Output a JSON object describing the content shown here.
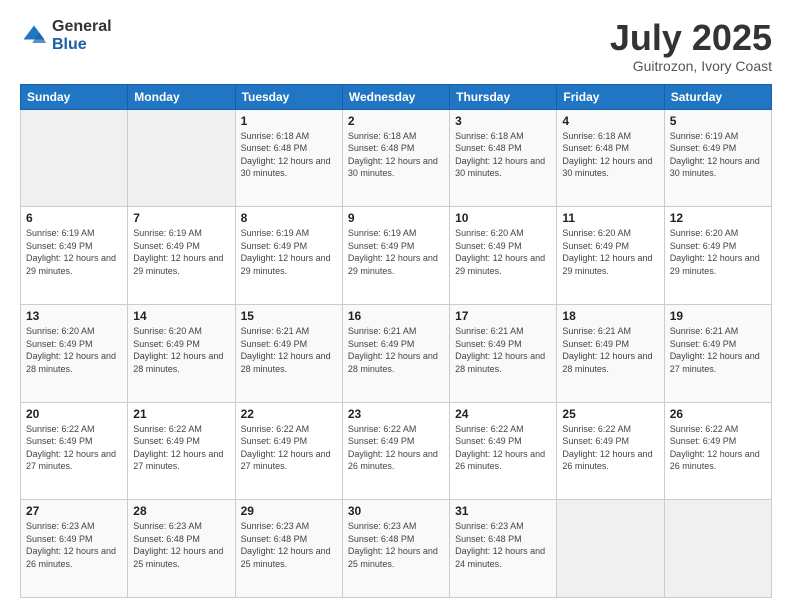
{
  "logo": {
    "general": "General",
    "blue": "Blue"
  },
  "header": {
    "month": "July 2025",
    "location": "Guitrozon, Ivory Coast"
  },
  "weekdays": [
    "Sunday",
    "Monday",
    "Tuesday",
    "Wednesday",
    "Thursday",
    "Friday",
    "Saturday"
  ],
  "weeks": [
    [
      {
        "day": "",
        "sunrise": "",
        "sunset": "",
        "daylight": ""
      },
      {
        "day": "",
        "sunrise": "",
        "sunset": "",
        "daylight": ""
      },
      {
        "day": "1",
        "sunrise": "Sunrise: 6:18 AM",
        "sunset": "Sunset: 6:48 PM",
        "daylight": "Daylight: 12 hours and 30 minutes."
      },
      {
        "day": "2",
        "sunrise": "Sunrise: 6:18 AM",
        "sunset": "Sunset: 6:48 PM",
        "daylight": "Daylight: 12 hours and 30 minutes."
      },
      {
        "day": "3",
        "sunrise": "Sunrise: 6:18 AM",
        "sunset": "Sunset: 6:48 PM",
        "daylight": "Daylight: 12 hours and 30 minutes."
      },
      {
        "day": "4",
        "sunrise": "Sunrise: 6:18 AM",
        "sunset": "Sunset: 6:48 PM",
        "daylight": "Daylight: 12 hours and 30 minutes."
      },
      {
        "day": "5",
        "sunrise": "Sunrise: 6:19 AM",
        "sunset": "Sunset: 6:49 PM",
        "daylight": "Daylight: 12 hours and 30 minutes."
      }
    ],
    [
      {
        "day": "6",
        "sunrise": "Sunrise: 6:19 AM",
        "sunset": "Sunset: 6:49 PM",
        "daylight": "Daylight: 12 hours and 29 minutes."
      },
      {
        "day": "7",
        "sunrise": "Sunrise: 6:19 AM",
        "sunset": "Sunset: 6:49 PM",
        "daylight": "Daylight: 12 hours and 29 minutes."
      },
      {
        "day": "8",
        "sunrise": "Sunrise: 6:19 AM",
        "sunset": "Sunset: 6:49 PM",
        "daylight": "Daylight: 12 hours and 29 minutes."
      },
      {
        "day": "9",
        "sunrise": "Sunrise: 6:19 AM",
        "sunset": "Sunset: 6:49 PM",
        "daylight": "Daylight: 12 hours and 29 minutes."
      },
      {
        "day": "10",
        "sunrise": "Sunrise: 6:20 AM",
        "sunset": "Sunset: 6:49 PM",
        "daylight": "Daylight: 12 hours and 29 minutes."
      },
      {
        "day": "11",
        "sunrise": "Sunrise: 6:20 AM",
        "sunset": "Sunset: 6:49 PM",
        "daylight": "Daylight: 12 hours and 29 minutes."
      },
      {
        "day": "12",
        "sunrise": "Sunrise: 6:20 AM",
        "sunset": "Sunset: 6:49 PM",
        "daylight": "Daylight: 12 hours and 29 minutes."
      }
    ],
    [
      {
        "day": "13",
        "sunrise": "Sunrise: 6:20 AM",
        "sunset": "Sunset: 6:49 PM",
        "daylight": "Daylight: 12 hours and 28 minutes."
      },
      {
        "day": "14",
        "sunrise": "Sunrise: 6:20 AM",
        "sunset": "Sunset: 6:49 PM",
        "daylight": "Daylight: 12 hours and 28 minutes."
      },
      {
        "day": "15",
        "sunrise": "Sunrise: 6:21 AM",
        "sunset": "Sunset: 6:49 PM",
        "daylight": "Daylight: 12 hours and 28 minutes."
      },
      {
        "day": "16",
        "sunrise": "Sunrise: 6:21 AM",
        "sunset": "Sunset: 6:49 PM",
        "daylight": "Daylight: 12 hours and 28 minutes."
      },
      {
        "day": "17",
        "sunrise": "Sunrise: 6:21 AM",
        "sunset": "Sunset: 6:49 PM",
        "daylight": "Daylight: 12 hours and 28 minutes."
      },
      {
        "day": "18",
        "sunrise": "Sunrise: 6:21 AM",
        "sunset": "Sunset: 6:49 PM",
        "daylight": "Daylight: 12 hours and 28 minutes."
      },
      {
        "day": "19",
        "sunrise": "Sunrise: 6:21 AM",
        "sunset": "Sunset: 6:49 PM",
        "daylight": "Daylight: 12 hours and 27 minutes."
      }
    ],
    [
      {
        "day": "20",
        "sunrise": "Sunrise: 6:22 AM",
        "sunset": "Sunset: 6:49 PM",
        "daylight": "Daylight: 12 hours and 27 minutes."
      },
      {
        "day": "21",
        "sunrise": "Sunrise: 6:22 AM",
        "sunset": "Sunset: 6:49 PM",
        "daylight": "Daylight: 12 hours and 27 minutes."
      },
      {
        "day": "22",
        "sunrise": "Sunrise: 6:22 AM",
        "sunset": "Sunset: 6:49 PM",
        "daylight": "Daylight: 12 hours and 27 minutes."
      },
      {
        "day": "23",
        "sunrise": "Sunrise: 6:22 AM",
        "sunset": "Sunset: 6:49 PM",
        "daylight": "Daylight: 12 hours and 26 minutes."
      },
      {
        "day": "24",
        "sunrise": "Sunrise: 6:22 AM",
        "sunset": "Sunset: 6:49 PM",
        "daylight": "Daylight: 12 hours and 26 minutes."
      },
      {
        "day": "25",
        "sunrise": "Sunrise: 6:22 AM",
        "sunset": "Sunset: 6:49 PM",
        "daylight": "Daylight: 12 hours and 26 minutes."
      },
      {
        "day": "26",
        "sunrise": "Sunrise: 6:22 AM",
        "sunset": "Sunset: 6:49 PM",
        "daylight": "Daylight: 12 hours and 26 minutes."
      }
    ],
    [
      {
        "day": "27",
        "sunrise": "Sunrise: 6:23 AM",
        "sunset": "Sunset: 6:49 PM",
        "daylight": "Daylight: 12 hours and 26 minutes."
      },
      {
        "day": "28",
        "sunrise": "Sunrise: 6:23 AM",
        "sunset": "Sunset: 6:48 PM",
        "daylight": "Daylight: 12 hours and 25 minutes."
      },
      {
        "day": "29",
        "sunrise": "Sunrise: 6:23 AM",
        "sunset": "Sunset: 6:48 PM",
        "daylight": "Daylight: 12 hours and 25 minutes."
      },
      {
        "day": "30",
        "sunrise": "Sunrise: 6:23 AM",
        "sunset": "Sunset: 6:48 PM",
        "daylight": "Daylight: 12 hours and 25 minutes."
      },
      {
        "day": "31",
        "sunrise": "Sunrise: 6:23 AM",
        "sunset": "Sunset: 6:48 PM",
        "daylight": "Daylight: 12 hours and 24 minutes."
      },
      {
        "day": "",
        "sunrise": "",
        "sunset": "",
        "daylight": ""
      },
      {
        "day": "",
        "sunrise": "",
        "sunset": "",
        "daylight": ""
      }
    ]
  ]
}
